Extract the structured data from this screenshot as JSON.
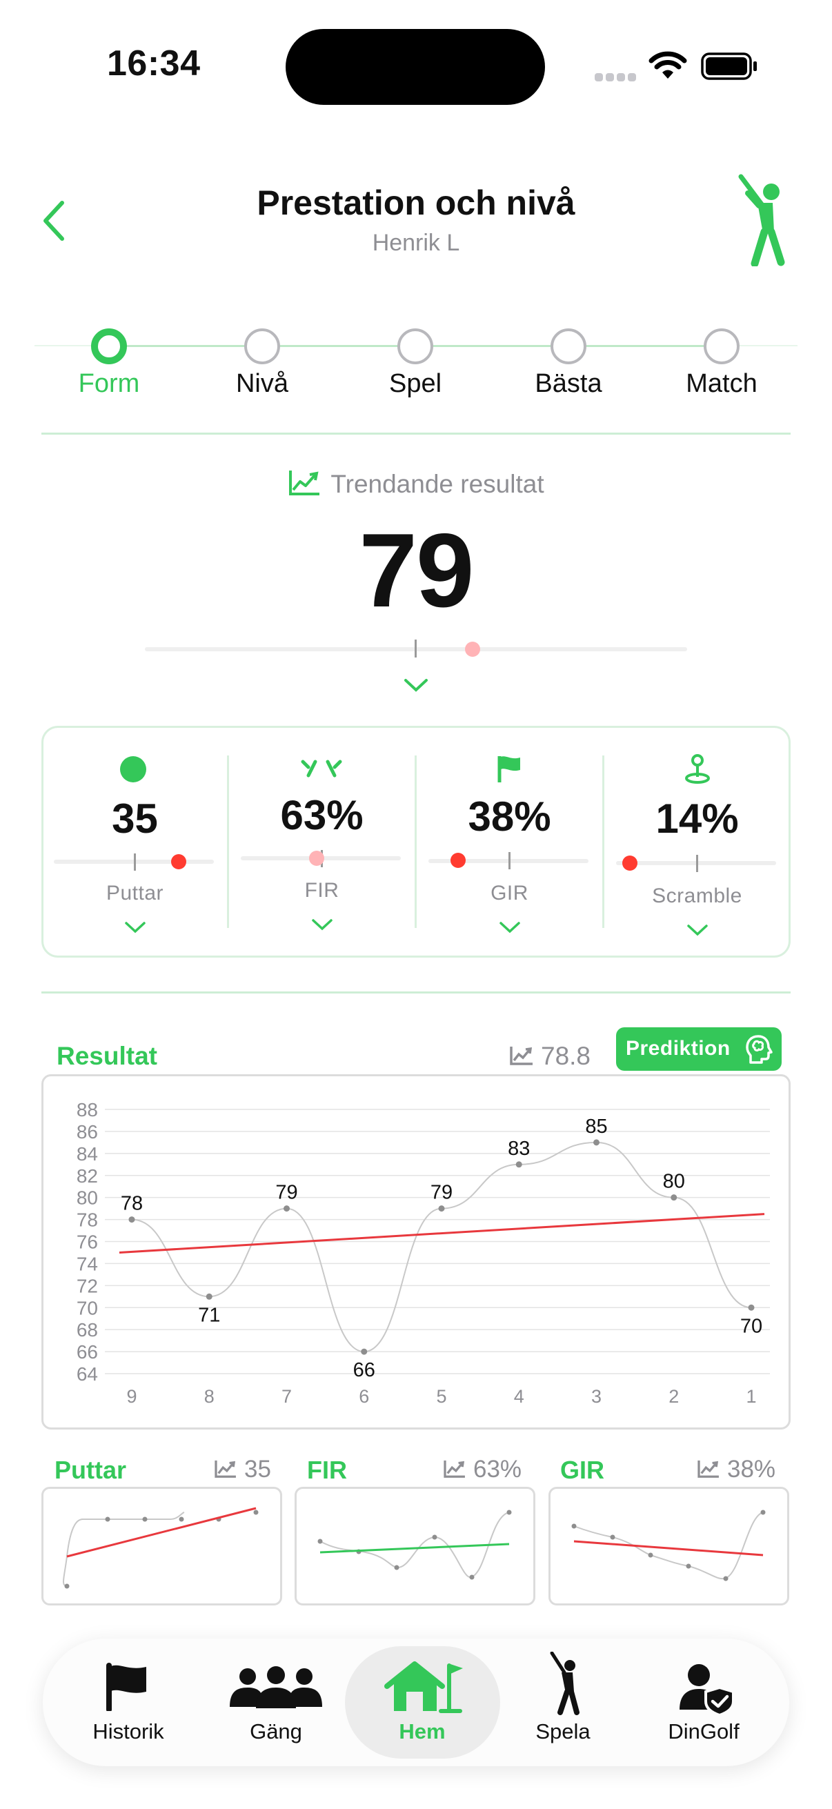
{
  "status_bar": {
    "time": "16:34"
  },
  "header": {
    "title": "Prestation och nivå",
    "subtitle": "Henrik L"
  },
  "stepper": {
    "items": [
      {
        "label": "Form",
        "active": true
      },
      {
        "label": "Nivå",
        "active": false
      },
      {
        "label": "Spel",
        "active": false
      },
      {
        "label": "Bästa",
        "active": false
      },
      {
        "label": "Match",
        "active": false
      }
    ]
  },
  "trend": {
    "label": "Trendande resultat",
    "value": "79"
  },
  "stats": [
    {
      "value": "35",
      "label": "Puttar",
      "icon": "ball-icon"
    },
    {
      "value": "63%",
      "label": "FIR",
      "icon": "fairway-icon"
    },
    {
      "value": "38%",
      "label": "GIR",
      "icon": "flag-icon"
    },
    {
      "value": "14%",
      "label": "Scramble",
      "icon": "pin-icon"
    }
  ],
  "results": {
    "title": "Resultat",
    "average": "78.8",
    "prediction_label": "Prediktion"
  },
  "chart_data": {
    "type": "line",
    "categories": [
      "9",
      "8",
      "7",
      "6",
      "5",
      "4",
      "3",
      "2",
      "1"
    ],
    "values": [
      78,
      71,
      79,
      66,
      79,
      83,
      85,
      80,
      70
    ],
    "data_labels": [
      "78",
      "71",
      "79",
      "66",
      "79",
      "83",
      "85",
      "80",
      "70"
    ],
    "ylim": [
      64,
      88
    ],
    "yticks": [
      "88",
      "86",
      "84",
      "82",
      "80",
      "78",
      "76",
      "74",
      "72",
      "70",
      "68",
      "66",
      "64"
    ],
    "trendline": {
      "start": 75.0,
      "end": 78.5,
      "color": "#e8383d"
    },
    "grid": true,
    "colors": {
      "line": "#c8c8c8",
      "point": "#8e8e8e"
    }
  },
  "mini_charts": [
    {
      "title": "Puttar",
      "average": "35"
    },
    {
      "title": "FIR",
      "average": "63%"
    },
    {
      "title": "GIR",
      "average": "38%"
    }
  ],
  "tabbar": {
    "items": [
      {
        "label": "Historik",
        "icon": "flag-icon"
      },
      {
        "label": "Gäng",
        "icon": "group-icon"
      },
      {
        "label": "Hem",
        "icon": "home-icon",
        "active": true
      },
      {
        "label": "Spela",
        "icon": "golfer-icon"
      },
      {
        "label": "DinGolf",
        "icon": "user-shield-icon"
      }
    ]
  },
  "colors": {
    "accent": "#34C759",
    "alert": "#ff3b30",
    "trend_red": "#e8383d"
  }
}
